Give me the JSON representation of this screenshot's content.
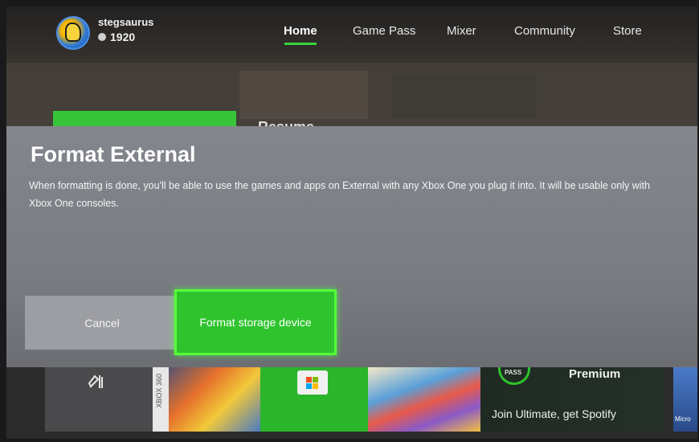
{
  "profile": {
    "gamertag": "stegsaurus",
    "gamerscore": "1920"
  },
  "nav": {
    "tabs": [
      "Home",
      "Game Pass",
      "Mixer",
      "Community",
      "Store"
    ],
    "active": "Home"
  },
  "background": {
    "resume_label": "Resume"
  },
  "dialog": {
    "title": "Format External",
    "body": "When formatting is done, you'll be able to use the games and apps on External with any Xbox One you plug it into. It will be usable only with Xbox One consoles.",
    "cancel_label": "Cancel",
    "confirm_label": "Format storage device"
  },
  "tiles": {
    "xbox360_label": "XBOX 360",
    "gamepass_premium": "Premium",
    "gamepass_badge": "PASS",
    "gamepass_caption": "Join Ultimate, get Spotify",
    "edge_label": "Micro"
  },
  "colors": {
    "accent_green": "#2fc42e",
    "focus_green": "#55ff3a",
    "dialog_gray": "#87898f"
  }
}
